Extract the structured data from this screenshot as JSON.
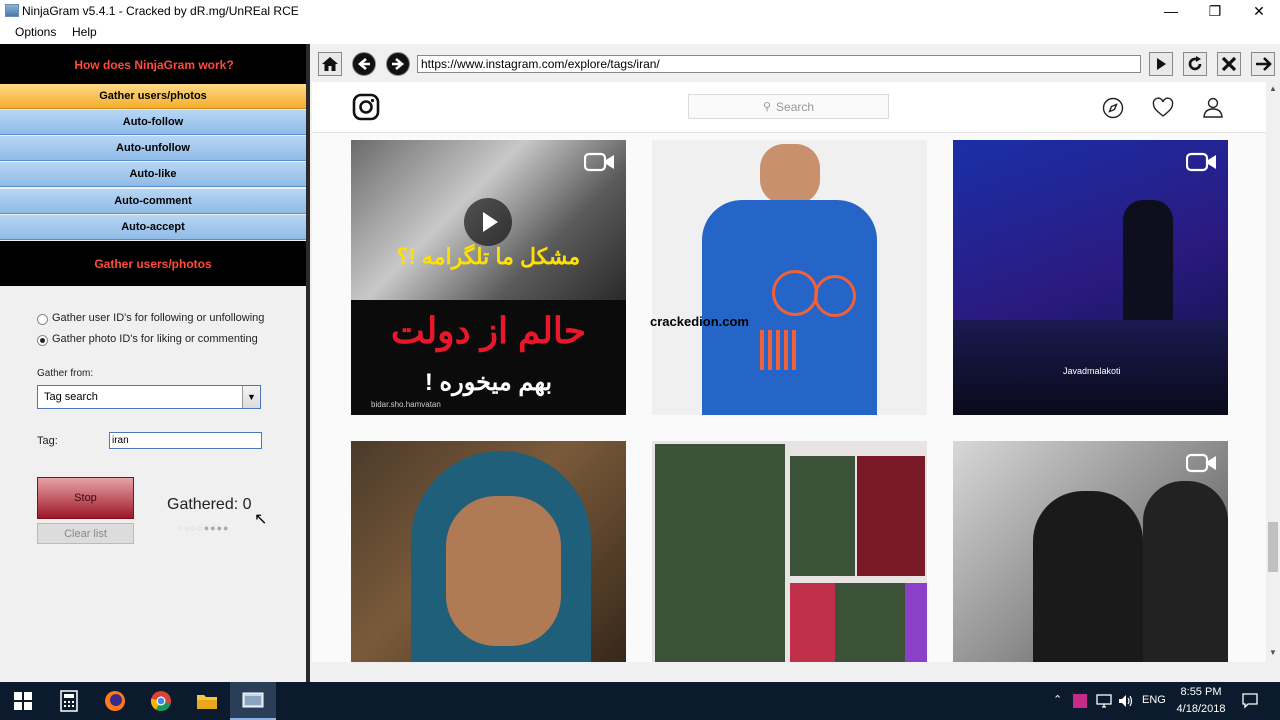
{
  "window": {
    "title": "NinjaGram v5.4.1 - Cracked by dR.mg/UnREal RCE"
  },
  "menu": {
    "options": "Options",
    "help": "Help"
  },
  "left_panel": {
    "header": "How does NinjaGram work?",
    "nav": [
      {
        "label": "Gather users/photos",
        "active": true
      },
      {
        "label": "Auto-follow",
        "active": false
      },
      {
        "label": "Auto-unfollow",
        "active": false
      },
      {
        "label": "Auto-like",
        "active": false
      },
      {
        "label": "Auto-comment",
        "active": false
      },
      {
        "label": "Auto-accept",
        "active": false
      }
    ],
    "section_title": "Gather users/photos",
    "radio_users": "Gather user ID's for following or unfollowing",
    "radio_photos": "Gather photo ID's for liking or commenting",
    "gather_from_label": "Gather from:",
    "gather_from_value": "Tag search",
    "tag_label": "Tag:",
    "tag_value": "iran",
    "stop_label": "Stop",
    "clear_label": "Clear list",
    "gathered_text": "Gathered: 0"
  },
  "browser": {
    "url": "https://www.instagram.com/explore/tags/iran/",
    "search_placeholder": "Search",
    "watermark": "crackedion.com",
    "tile1_text_top": "مشکل ما تلگرامه !؟",
    "tile1_text_mid": "حالم از دولت",
    "tile1_text_bottom": "بهم میخوره !",
    "tile1_credit": "bidar.sho.hamvatan",
    "tile3_credit": "Javadmalakoti"
  },
  "taskbar": {
    "time": "8:55 PM",
    "date": "4/18/2018",
    "lang": "ENG"
  },
  "colors": {
    "accent_orange": "#f4ae2e",
    "nav_blue": "#8fbbe8",
    "header_red": "#ff4a3d",
    "stop_red": "#9e1828"
  }
}
